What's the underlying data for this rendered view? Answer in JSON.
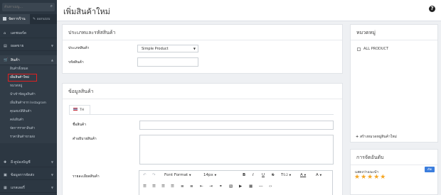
{
  "sidebar": {
    "search_placeholder": "ค้นหาเมนู...",
    "mode_tabs": [
      "จัดการร้าน",
      "ออกแบบ"
    ],
    "nav": [
      "แดชบอร์ด",
      "ยอดขาย",
      "สินค้า",
      "อี-คูปองบัญชี",
      "ข้อมูลการจัดส่ง",
      "แกลเลอรี่"
    ],
    "sub_items": [
      "สินค้าทั้งหมด",
      "เพิ่มสินค้าใหม่",
      "หมวดหมู่",
      "นำเข้าข้อมูลสินค้า",
      "เพิ่มสินค้าจาก Instagram",
      "คุณสมบัติสินค้า",
      "คลังสินค้า",
      "จัดการราคาสินค้า",
      "ราคาสินค้าขายส่ง"
    ]
  },
  "topbar": {
    "title": "เพิ่มสินค้าใหม่",
    "help": "?"
  },
  "type_panel": {
    "title": "ประเภทและรหัสสินค้า",
    "product_type_label": "ประเภทสินค้า",
    "product_type_value": "Simple Product",
    "sku_label": "รหัสสินค้า"
  },
  "info_panel": {
    "title": "ข้อมูลสินค้า",
    "lang_tab": "TH",
    "name_label": "ชื่อสินค้า",
    "desc_label": "คำอธิบายสินค้า",
    "detail_label": "รายละเอียดสินค้า",
    "toolbar": {
      "format": "Font Format",
      "size": "14px",
      "line_height": "0.2",
      "bold": "B",
      "italic": "I",
      "underline": "U",
      "strike": "S",
      "text_height": "T",
      "font_color": "A",
      "highlight": "A"
    }
  },
  "category_panel": {
    "title": "หมวดหมู่",
    "items": [
      "ALL PRODUCT"
    ],
    "add_link": "สร้างหมวดหมู่สินค้าใหม่"
  },
  "sort_panel": {
    "title": "การจัดอันดับ",
    "recommend_label": "แสดงว่าแนะนำ",
    "toggle": "เปิด",
    "stars": "★★★★★"
  }
}
